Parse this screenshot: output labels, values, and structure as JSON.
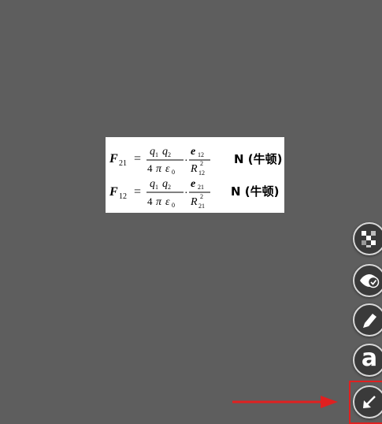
{
  "formula": {
    "line1": {
      "lhs_symbol": "F",
      "lhs_subscript": "21",
      "equals": "=",
      "num_q1": "q",
      "num_q1_sub": "1",
      "num_q2": "q",
      "num_q2_sub": "2",
      "den_coef": "4",
      "den_pi": "π",
      "den_eps": "ε",
      "den_eps_sub": "0",
      "dot": "·",
      "unit_vec": "e",
      "unit_vec_sub": "12",
      "R": "R",
      "R_sup": "2",
      "R_sub": "12",
      "unit": "N (牛顿)"
    },
    "line2": {
      "lhs_symbol": "F",
      "lhs_subscript": "12",
      "equals": "=",
      "num_q1": "q",
      "num_q1_sub": "1",
      "num_q2": "q",
      "num_q2_sub": "2",
      "den_coef": "4",
      "den_pi": "π",
      "den_eps": "ε",
      "den_eps_sub": "0",
      "dot": "·",
      "unit_vec": "e",
      "unit_vec_sub": "21",
      "R": "R",
      "R_sup": "2",
      "R_sub": "21",
      "unit": "N (牛顿)"
    }
  },
  "toolbar": {
    "tools": [
      {
        "name": "mosaic",
        "icon": "mosaic-icon"
      },
      {
        "name": "hide",
        "icon": "eye-check-icon"
      },
      {
        "name": "pen",
        "icon": "pen-icon"
      },
      {
        "name": "text",
        "icon": "text-icon",
        "glyph": "a"
      },
      {
        "name": "arrow",
        "icon": "arrow-icon"
      }
    ]
  },
  "colors": {
    "background": "#5e5e5e",
    "button_fill": "#3a3a3a",
    "button_border": "#d8d8d8",
    "highlight": "#e02020"
  }
}
